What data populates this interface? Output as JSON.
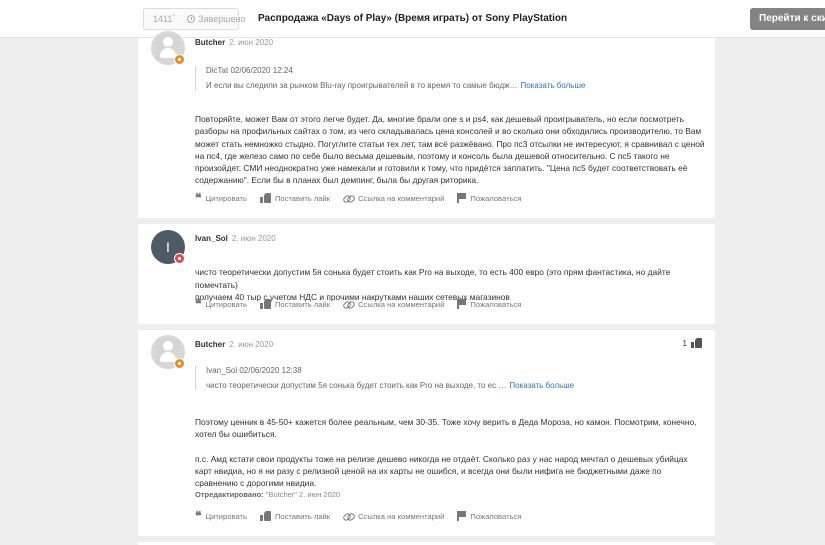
{
  "header": {
    "rating": "1411",
    "rating_unit": "°",
    "status": "Завершено",
    "title": "Распродажа «Days of Play» (Время играть) от Sony PlayStation",
    "store_button": "Перейти к скидке"
  },
  "actions": {
    "quote": "Цитировать",
    "like": "Поставить лайк",
    "link": "Ссылка на комментарий",
    "report": "Пожаловаться"
  },
  "comments": [
    {
      "author": "Butcher",
      "date": "2. июн 2020",
      "quote_meta": "DicTat 02/06/2020 12:24",
      "quote_text": "И если вы следили за рынком Blu-ray проигрывателей в то время то самые бюдж…",
      "show_more": "Показать больше",
      "body": [
        "Повторяйте, может Вам от этого легче будет. Да, многие брали one s и ps4, как дешевый проигрыватель, но если посмотреть разборы на профильных сайтах о том, из чего складывалась цена консолей и во сколько они обходились производителю, то Вам может стать немножко стыдно. Погуглите статьи тех лет, там всё разжёвано. Про пс3 отсылки не интересуют, я сравнивал с ценой на пс4, где железо само по себе было весьма дешевым, поэтому и консоль была дешевой относительно. С пс5 такого не произойдет. СМИ неоднократно уже намекали и готовили к тому, что придётся заплатить. \"Цена пс5 будет соответствовать её содержанию\". Если бы в планах был демпинг, была бы другая риторика."
      ]
    },
    {
      "author": "Ivan_Sol",
      "date": "2. июн 2020",
      "avatar_letter": "I",
      "body": [
        "чисто теоретически допустим 5я сонька будет стоить как Pro на выходе, то есть 400 евро (это прям фантастика, но дайте помечтать)\nполучаем 40 тыр с учетом НДС и прочими накрутками наших сетевых магазинов"
      ]
    },
    {
      "author": "Butcher",
      "date": "2. июн 2020",
      "votes": "1",
      "quote_meta": "Ivan_Sol 02/06/2020 12:38",
      "quote_text": "чисто теоретически допустим 5я сонька будет стоить как Pro на выходе, то ес …",
      "show_more": "Показать больше",
      "body": [
        "Поэтому ценник в 45-50+ кажется более реальным, чем 30-35. Тоже хочу верить в Деда Мороза, но камон. Посмотрим, конечно, хотел бы ошибиться.",
        "п.с. Амд кстати свои продукты тоже на релизе дешево никогда не отдаёт. Сколько раз у нас народ мечтал о дешевых убийцах карт нвидиа, но я ни разу с релизной ценой на их карты не ошибся, и всегда они были нифига не бюджетными даже по сравнению с дорогими нвидиа."
      ],
      "edited_label": "Отредактировано:",
      "edited_text": "\"Butcher\" 2. июн 2020"
    }
  ]
}
